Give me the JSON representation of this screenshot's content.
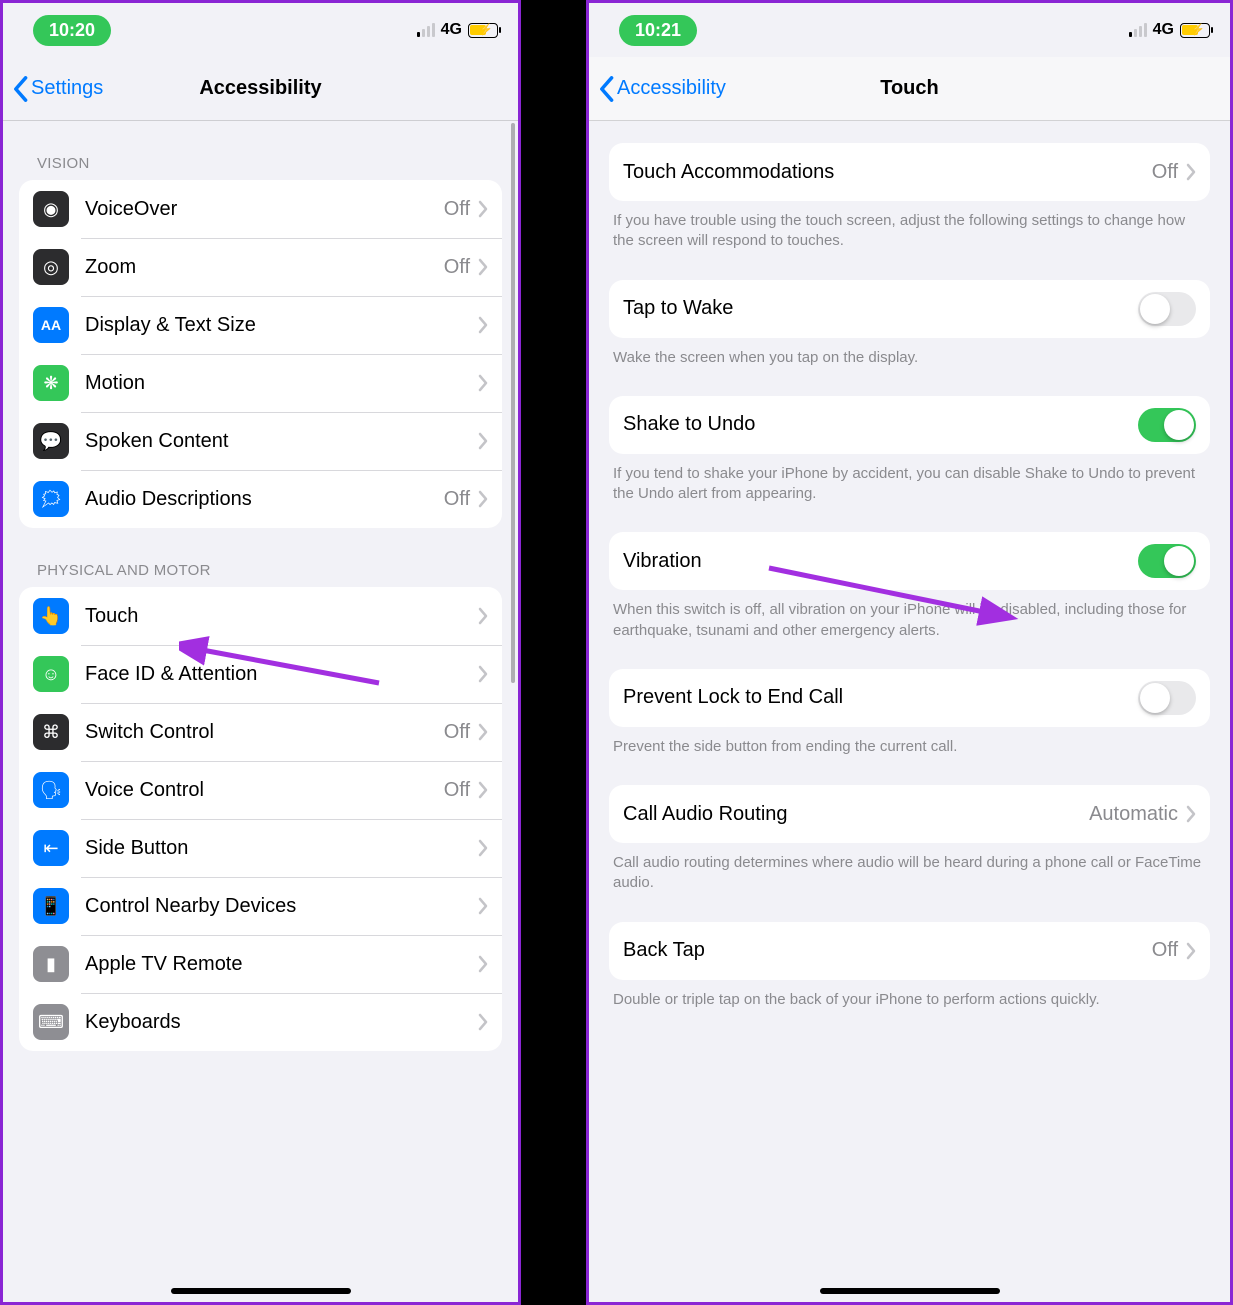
{
  "left": {
    "status": {
      "time": "10:20",
      "net": "4G"
    },
    "nav": {
      "back": "Settings",
      "title": "Accessibility"
    },
    "vision": {
      "header": "VISION",
      "items": [
        {
          "label": "VoiceOver",
          "value": "Off",
          "chevron": true,
          "icon": "voiceover",
          "color": "ic-black"
        },
        {
          "label": "Zoom",
          "value": "Off",
          "chevron": true,
          "icon": "zoom",
          "color": "ic-black"
        },
        {
          "label": "Display & Text Size",
          "value": "",
          "chevron": true,
          "icon": "textsize",
          "color": "ic-blue"
        },
        {
          "label": "Motion",
          "value": "",
          "chevron": true,
          "icon": "motion",
          "color": "ic-green"
        },
        {
          "label": "Spoken Content",
          "value": "",
          "chevron": true,
          "icon": "spoken",
          "color": "ic-black"
        },
        {
          "label": "Audio Descriptions",
          "value": "Off",
          "chevron": true,
          "icon": "audio",
          "color": "ic-blue"
        }
      ]
    },
    "motor": {
      "header": "PHYSICAL AND MOTOR",
      "items": [
        {
          "label": "Touch",
          "value": "",
          "chevron": true,
          "icon": "touch",
          "color": "ic-blue"
        },
        {
          "label": "Face ID & Attention",
          "value": "",
          "chevron": true,
          "icon": "faceid",
          "color": "ic-green"
        },
        {
          "label": "Switch Control",
          "value": "Off",
          "chevron": true,
          "icon": "switch",
          "color": "ic-black"
        },
        {
          "label": "Voice Control",
          "value": "Off",
          "chevron": true,
          "icon": "voicectl",
          "color": "ic-blue"
        },
        {
          "label": "Side Button",
          "value": "",
          "chevron": true,
          "icon": "sidebtn",
          "color": "ic-blue"
        },
        {
          "label": "Control Nearby Devices",
          "value": "",
          "chevron": true,
          "icon": "nearby",
          "color": "ic-blue"
        },
        {
          "label": "Apple TV Remote",
          "value": "",
          "chevron": true,
          "icon": "tvremote",
          "color": "ic-gray"
        },
        {
          "label": "Keyboards",
          "value": "",
          "chevron": true,
          "icon": "keyboard",
          "color": "ic-gray"
        }
      ]
    }
  },
  "right": {
    "status": {
      "time": "10:21",
      "net": "4G"
    },
    "nav": {
      "back": "Accessibility",
      "title": "Touch"
    },
    "rows": {
      "touch_accom": {
        "label": "Touch Accommodations",
        "value": "Off"
      },
      "touch_accom_footer": "If you have trouble using the touch screen, adjust the following settings to change how the screen will respond to touches.",
      "tap_to_wake": {
        "label": "Tap to Wake",
        "on": false
      },
      "tap_to_wake_footer": "Wake the screen when you tap on the display.",
      "shake_undo": {
        "label": "Shake to Undo",
        "on": true
      },
      "shake_undo_footer": "If you tend to shake your iPhone by accident, you can disable Shake to Undo to prevent the Undo alert from appearing.",
      "vibration": {
        "label": "Vibration",
        "on": true
      },
      "vibration_footer": "When this switch is off, all vibration on your iPhone will be disabled, including those for earthquake, tsunami and other emergency alerts.",
      "prevent_lock": {
        "label": "Prevent Lock to End Call",
        "on": false
      },
      "prevent_lock_footer": "Prevent the side button from ending the current call.",
      "call_audio": {
        "label": "Call Audio Routing",
        "value": "Automatic"
      },
      "call_audio_footer": "Call audio routing determines where audio will be heard during a phone call or FaceTime audio.",
      "back_tap": {
        "label": "Back Tap",
        "value": "Off"
      },
      "back_tap_footer": "Double or triple tap on the back of your iPhone to perform actions quickly."
    }
  }
}
